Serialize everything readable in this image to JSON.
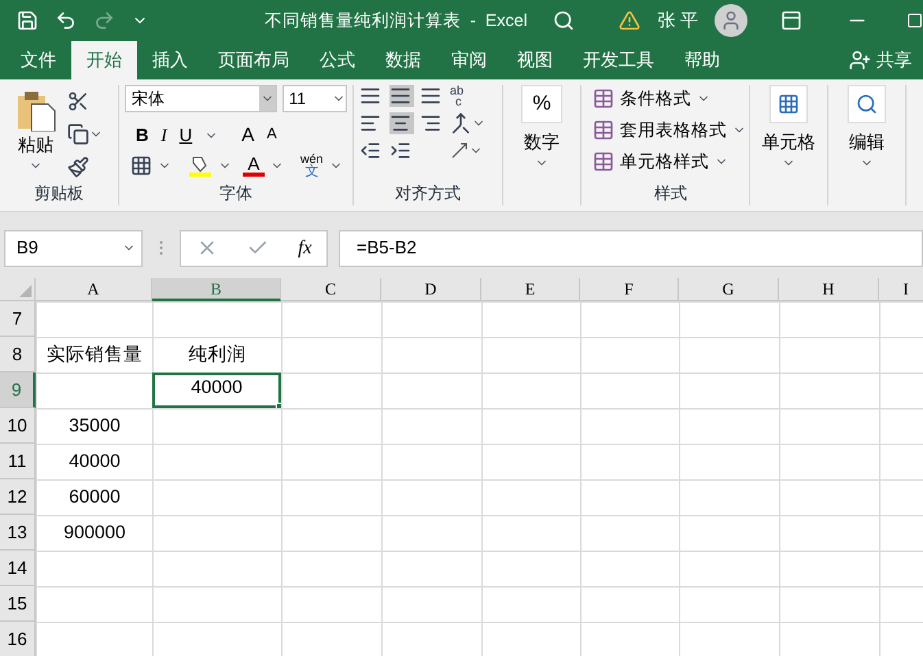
{
  "window": {
    "title": "不同销售量纯利润计算表  -  Excel",
    "user": "张 平"
  },
  "quick_access": [
    {
      "kind": "save",
      "disabled": false
    },
    {
      "kind": "undo",
      "disabled": false
    },
    {
      "kind": "redo",
      "disabled": true
    }
  ],
  "tabs": [
    {
      "label": "文件",
      "selected": false
    },
    {
      "label": "开始",
      "selected": true
    },
    {
      "label": "插入",
      "selected": false
    },
    {
      "label": "页面布局",
      "selected": false
    },
    {
      "label": "公式",
      "selected": false
    },
    {
      "label": "数据",
      "selected": false
    },
    {
      "label": "审阅",
      "selected": false
    },
    {
      "label": "视图",
      "selected": false
    },
    {
      "label": "开发工具",
      "selected": false
    },
    {
      "label": "帮助",
      "selected": false
    }
  ],
  "share": "共享",
  "ribbon": {
    "clipboard": {
      "label": "剪贴板",
      "paste": "粘贴"
    },
    "font": {
      "label": "字体",
      "font_name": "宋体",
      "font_size": "11",
      "bold": "B",
      "italic": "I",
      "underline": "U",
      "grow": "A",
      "shrink": "A",
      "font_color": "A",
      "phonetic_top": "wén",
      "phonetic_bottom": "文"
    },
    "alignment": {
      "label": "对齐方式",
      "wrap_top": "ab",
      "wrap_bottom": "c"
    },
    "number": {
      "label": "数字",
      "symbol": "%"
    },
    "styles": {
      "label": "样式",
      "items": [
        "条件格式",
        "套用表格格式",
        "单元格样式"
      ]
    },
    "cells": {
      "label": "单元格"
    },
    "editing": {
      "label": "编辑"
    }
  },
  "formula_bar": {
    "name_box": "B9",
    "fx": "fx",
    "formula": "=B5-B2"
  },
  "sheet": {
    "columns": [
      {
        "label": "A",
        "selected": false
      },
      {
        "label": "B",
        "selected": true
      },
      {
        "label": "C",
        "selected": false
      },
      {
        "label": "D",
        "selected": false
      },
      {
        "label": "E",
        "selected": false
      },
      {
        "label": "F",
        "selected": false
      },
      {
        "label": "G",
        "selected": false
      },
      {
        "label": "H",
        "selected": false
      },
      {
        "label": "I",
        "selected": false
      }
    ],
    "rows": [
      {
        "number": "7",
        "selected": false,
        "cells": [
          {
            "selected": false
          },
          {
            "selected": false
          },
          {
            "selected": false
          },
          {
            "selected": false
          },
          {
            "selected": false
          },
          {
            "selected": false
          },
          {
            "selected": false
          },
          {
            "selected": false
          },
          {
            "selected": false
          }
        ]
      },
      {
        "number": "8",
        "selected": false,
        "cells": [
          {
            "text": "实际销售量",
            "selected": false
          },
          {
            "text": "纯利润",
            "selected": false
          },
          {
            "selected": false
          },
          {
            "selected": false
          },
          {
            "selected": false
          },
          {
            "selected": false
          },
          {
            "selected": false
          },
          {
            "selected": false
          },
          {
            "selected": false
          }
        ]
      },
      {
        "number": "9",
        "selected": true,
        "cells": [
          {
            "selected": false
          },
          {
            "text": "40000",
            "selected": true
          },
          {
            "selected": false
          },
          {
            "selected": false
          },
          {
            "selected": false
          },
          {
            "selected": false
          },
          {
            "selected": false
          },
          {
            "selected": false
          },
          {
            "selected": false
          }
        ]
      },
      {
        "number": "10",
        "selected": false,
        "cells": [
          {
            "text": "35000",
            "selected": false
          },
          {
            "selected": false
          },
          {
            "selected": false
          },
          {
            "selected": false
          },
          {
            "selected": false
          },
          {
            "selected": false
          },
          {
            "selected": false
          },
          {
            "selected": false
          },
          {
            "selected": false
          }
        ]
      },
      {
        "number": "11",
        "selected": false,
        "cells": [
          {
            "text": "40000",
            "selected": false
          },
          {
            "selected": false
          },
          {
            "selected": false
          },
          {
            "selected": false
          },
          {
            "selected": false
          },
          {
            "selected": false
          },
          {
            "selected": false
          },
          {
            "selected": false
          },
          {
            "selected": false
          }
        ]
      },
      {
        "number": "12",
        "selected": false,
        "cells": [
          {
            "text": "60000",
            "selected": false
          },
          {
            "selected": false
          },
          {
            "selected": false
          },
          {
            "selected": false
          },
          {
            "selected": false
          },
          {
            "selected": false
          },
          {
            "selected": false
          },
          {
            "selected": false
          },
          {
            "selected": false
          }
        ]
      },
      {
        "number": "13",
        "selected": false,
        "cells": [
          {
            "text": "900000",
            "selected": false
          },
          {
            "selected": false
          },
          {
            "selected": false
          },
          {
            "selected": false
          },
          {
            "selected": false
          },
          {
            "selected": false
          },
          {
            "selected": false
          },
          {
            "selected": false
          },
          {
            "selected": false
          }
        ]
      },
      {
        "number": "14",
        "selected": false,
        "cells": [
          {
            "selected": false
          },
          {
            "selected": false
          },
          {
            "selected": false
          },
          {
            "selected": false
          },
          {
            "selected": false
          },
          {
            "selected": false
          },
          {
            "selected": false
          },
          {
            "selected": false
          },
          {
            "selected": false
          }
        ]
      },
      {
        "number": "15",
        "selected": false,
        "cells": [
          {
            "selected": false
          },
          {
            "selected": false
          },
          {
            "selected": false
          },
          {
            "selected": false
          },
          {
            "selected": false
          },
          {
            "selected": false
          },
          {
            "selected": false
          },
          {
            "selected": false
          },
          {
            "selected": false
          }
        ]
      },
      {
        "number": "16",
        "selected": false,
        "cells": [
          {
            "selected": false
          },
          {
            "selected": false
          },
          {
            "selected": false
          },
          {
            "selected": false
          },
          {
            "selected": false
          },
          {
            "selected": false
          },
          {
            "selected": false
          },
          {
            "selected": false
          },
          {
            "selected": false
          }
        ]
      }
    ]
  }
}
